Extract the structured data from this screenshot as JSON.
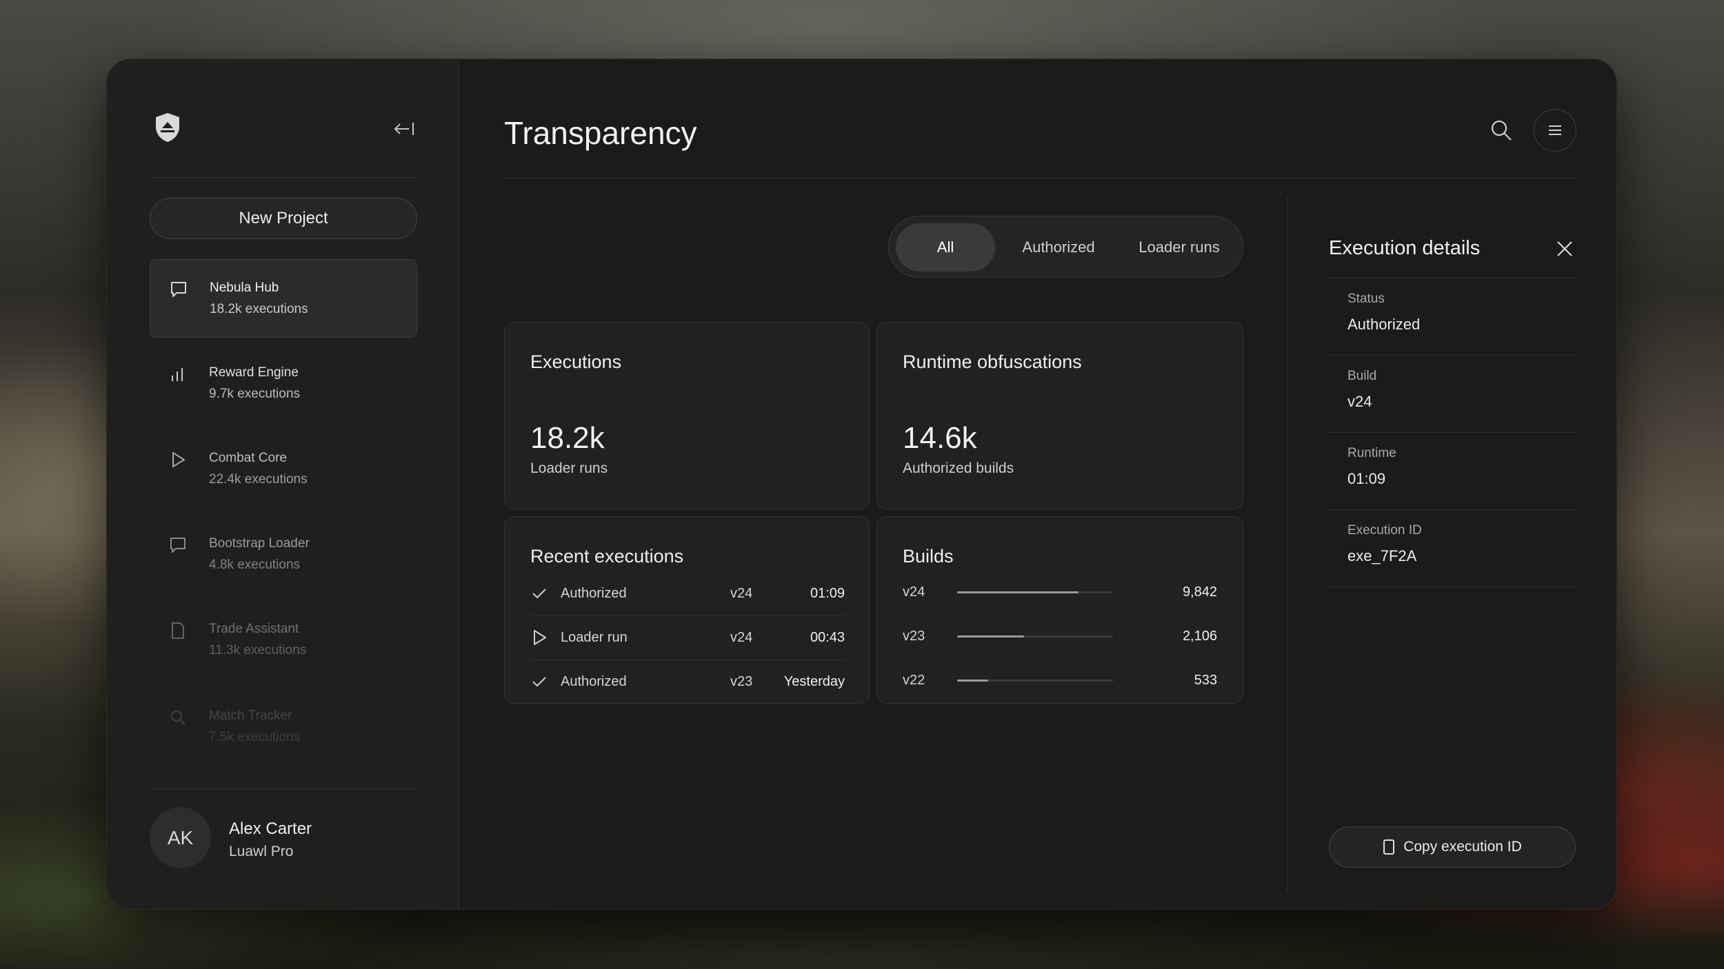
{
  "app": {
    "title": "Transparency"
  },
  "sidebar": {
    "collapse_icon": "collapse-left-icon",
    "new_project_label": "New Project",
    "items": [
      {
        "name": "Nebula Hub",
        "sub": "18.2k executions",
        "icon": "message-icon",
        "active": true
      },
      {
        "name": "Reward Engine",
        "sub": "9.7k executions",
        "icon": "bar-chart-icon",
        "active": false
      },
      {
        "name": "Combat Core",
        "sub": "22.4k executions",
        "icon": "play-icon",
        "active": false
      },
      {
        "name": "Bootstrap Loader",
        "sub": "4.8k executions",
        "icon": "message-icon",
        "active": false
      },
      {
        "name": "Trade Assistant",
        "sub": "11.3k executions",
        "icon": "document-icon",
        "active": false
      },
      {
        "name": "Match Tracker",
        "sub": "7.5k executions",
        "icon": "search-icon",
        "active": false
      }
    ],
    "user": {
      "initials": "AK",
      "name": "Alex Carter",
      "plan": "Luawl Pro"
    }
  },
  "filter": {
    "tabs": [
      "All",
      "Authorized",
      "Loader runs"
    ],
    "selected": "All"
  },
  "cards": {
    "executions": {
      "title": "Executions",
      "value": "18.2k",
      "sub": "Loader runs"
    },
    "runtime": {
      "title": "Runtime obfuscations",
      "value": "14.6k",
      "sub": "Authorized builds"
    },
    "recent": {
      "title": "Recent executions",
      "rows": [
        {
          "icon": "check-icon",
          "label": "Authorized",
          "version": "v24",
          "time": "01:09"
        },
        {
          "icon": "play-icon",
          "label": "Loader run",
          "version": "v24",
          "time": "00:43"
        },
        {
          "icon": "check-icon",
          "label": "Authorized",
          "version": "v23",
          "time": "Yesterday"
        }
      ]
    },
    "builds": {
      "title": "Builds",
      "rows": [
        {
          "version": "v24",
          "value": "9,842",
          "fraction": 0.78
        },
        {
          "version": "v23",
          "value": "2,106",
          "fraction": 0.43
        },
        {
          "version": "v22",
          "value": "533",
          "fraction": 0.2
        }
      ]
    }
  },
  "details": {
    "title": "Execution details",
    "fields": [
      {
        "label": "Status",
        "value": "Authorized"
      },
      {
        "label": "Build",
        "value": "v24"
      },
      {
        "label": "Runtime",
        "value": "01:09"
      },
      {
        "label": "Execution ID",
        "value": "exe_7F2A"
      }
    ],
    "copy_label": "Copy execution ID"
  }
}
